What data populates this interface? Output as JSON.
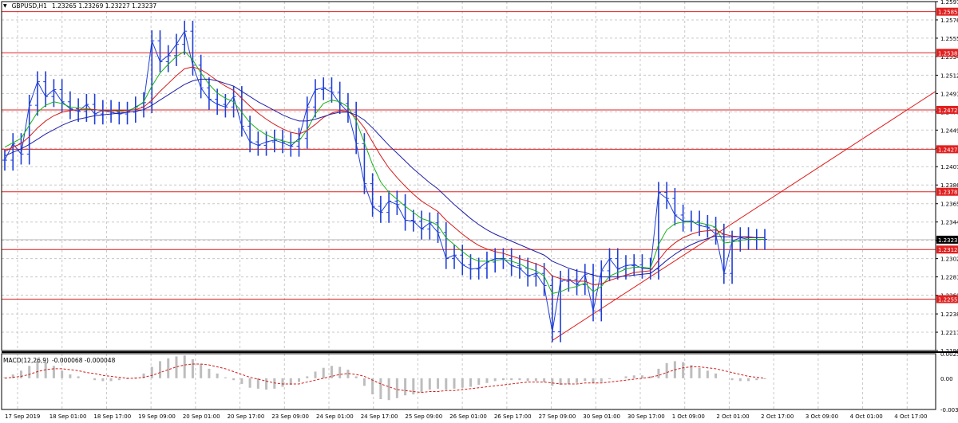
{
  "window": {
    "symbol": "GBPUSD,H1",
    "ohlc": "1.23265 1.23269 1.23227 1.23237",
    "macd_label": "MACD(12,26,9)",
    "macd_values": "-0.000068 -0.000048"
  },
  "colors": {
    "bar": "#1f3fd6",
    "grid": "#c8c8c8",
    "level": "#e02020",
    "ma_fast": "#17b317",
    "ma_mid": "#d41c1c",
    "ma_slow": "#2020a8",
    "trend": "#e02020",
    "macd_hist": "#bdbdbd",
    "macd_signal": "#d41c1c"
  },
  "chart_data": [
    {
      "type": "line",
      "title": "",
      "xlabel": "",
      "ylabel": "",
      "ylim": [
        1.21965,
        1.2597
      ],
      "grid": true,
      "x_tick_labels": [
        "17 Sep 2019",
        "18 Sep 01:00",
        "18 Sep 17:00",
        "19 Sep 09:00",
        "20 Sep 01:00",
        "20 Sep 17:00",
        "23 Sep 09:00",
        "24 Sep 01:00",
        "24 Sep 17:00",
        "25 Sep 09:00",
        "26 Sep 01:00",
        "26 Sep 17:00",
        "27 Sep 09:00",
        "30 Sep 01:00",
        "30 Sep 17:00",
        "1 Oct 09:00",
        "2 Oct 01:00",
        "2 Oct 17:00",
        "3 Oct 09:00",
        "4 Oct 01:00",
        "4 Oct 17:00"
      ],
      "y_tick_labels": [
        "1.25970",
        "1.25760",
        "1.25550",
        "1.25340",
        "1.25125",
        "1.24915",
        "1.24705",
        "1.24495",
        "1.24285",
        "1.24075",
        "1.23865",
        "1.23650",
        "1.23440",
        "1.23230",
        "1.23020",
        "1.22810",
        "1.22600",
        "1.22385",
        "1.22175",
        "1.21965"
      ],
      "price_levels": [
        "1.25854",
        "1.25382",
        "1.24727",
        "1.24275",
        "1.23787",
        "1.23124",
        "1.22555"
      ],
      "current_price": "1.23237",
      "series": [
        {
          "values": [
            1.2415,
            1.2434,
            1.2422,
            1.2478,
            1.2505,
            1.2488,
            1.2496,
            1.2482,
            1.2474,
            1.2471,
            1.2479,
            1.2468,
            1.2472,
            1.247,
            1.2468,
            1.247,
            1.2476,
            1.2481,
            1.2552,
            1.2528,
            1.2535,
            1.2548,
            1.2563,
            1.2524,
            1.2498,
            1.2485,
            1.2479,
            1.2476,
            1.2488,
            1.2454,
            1.2436,
            1.2432,
            1.2436,
            1.2438,
            1.2435,
            1.2431,
            1.244,
            1.2476,
            1.2496,
            1.2498,
            1.2493,
            1.248,
            1.247,
            1.2434,
            1.2388,
            1.2362,
            1.2355,
            1.2368,
            1.2364,
            1.2346,
            1.2345,
            1.2336,
            1.2343,
            1.2332,
            1.2302,
            1.2306,
            1.2295,
            1.229,
            1.2291,
            1.2298,
            1.2302,
            1.2302,
            1.2294,
            1.2291,
            1.2282,
            1.2285,
            1.2271,
            1.2218,
            1.2276,
            1.2278,
            1.2272,
            1.2284,
            1.2242,
            1.2288,
            1.2302,
            1.229,
            1.2294,
            1.2295,
            1.2291,
            1.229,
            1.2378,
            1.2371,
            1.2352,
            1.2345,
            1.2345,
            1.234,
            1.2338,
            1.233,
            1.2285,
            1.2322,
            1.2326,
            1.2324,
            1.2324,
            1.2324
          ]
        },
        {
          "values": [
            1.243,
            1.2435,
            1.244,
            1.2455,
            1.247,
            1.2478,
            1.2482,
            1.248,
            1.2476,
            1.2475,
            1.2474,
            1.2473,
            1.2472,
            1.2472,
            1.2471,
            1.2472,
            1.2475,
            1.2482,
            1.25,
            1.2515,
            1.2525,
            1.2534,
            1.254,
            1.253,
            1.2515,
            1.2502,
            1.2492,
            1.2486,
            1.2482,
            1.247,
            1.2458,
            1.245,
            1.2444,
            1.244,
            1.2437,
            1.2435,
            1.2437,
            1.245,
            1.2468,
            1.248,
            1.2484,
            1.2482,
            1.2476,
            1.246,
            1.2435,
            1.241,
            1.239,
            1.2378,
            1.237,
            1.2362,
            1.2355,
            1.2348,
            1.2345,
            1.234,
            1.2326,
            1.2318,
            1.231,
            1.2303,
            1.2299,
            1.2299,
            1.23,
            1.2301,
            1.2299,
            1.2296,
            1.2291,
            1.2288,
            1.2282,
            1.2262,
            1.2264,
            1.2268,
            1.227,
            1.2274,
            1.2264,
            1.227,
            1.2282,
            1.2286,
            1.229,
            1.2292,
            1.2292,
            1.2291,
            1.2318,
            1.2335,
            1.2342,
            1.2344,
            1.2344,
            1.2343,
            1.2341,
            1.2338,
            1.232,
            1.2321,
            1.2323,
            1.2324,
            1.2324,
            1.2324
          ]
        },
        {
          "values": [
            1.2425,
            1.243,
            1.2434,
            1.2442,
            1.2452,
            1.246,
            1.2466,
            1.247,
            1.2472,
            1.2473,
            1.2473,
            1.2473,
            1.2472,
            1.2472,
            1.2472,
            1.2472,
            1.2473,
            1.2476,
            1.2484,
            1.2494,
            1.2503,
            1.2512,
            1.252,
            1.2522,
            1.2519,
            1.2513,
            1.2506,
            1.25,
            1.2495,
            1.2486,
            1.2477,
            1.2469,
            1.2462,
            1.2456,
            1.2451,
            1.2447,
            1.2445,
            1.2449,
            1.2456,
            1.2464,
            1.2469,
            1.2472,
            1.2471,
            1.2464,
            1.2452,
            1.2436,
            1.242,
            1.2406,
            1.2395,
            1.2385,
            1.2376,
            1.2368,
            1.2362,
            1.2356,
            1.2346,
            1.2338,
            1.233,
            1.2323,
            1.2317,
            1.2313,
            1.231,
            1.2308,
            1.2305,
            1.2302,
            1.2299,
            1.2296,
            1.2292,
            1.2282,
            1.2279,
            1.2277,
            1.2276,
            1.2276,
            1.2272,
            1.2273,
            1.2277,
            1.228,
            1.2283,
            1.2286,
            1.2287,
            1.2288,
            1.23,
            1.2312,
            1.232,
            1.2326,
            1.233,
            1.2333,
            1.2334,
            1.2335,
            1.233,
            1.2328,
            1.2327,
            1.2326,
            1.2326,
            1.2326
          ]
        },
        {
          "values": [
            1.242,
            1.2424,
            1.2428,
            1.2433,
            1.2439,
            1.2445,
            1.245,
            1.2455,
            1.2459,
            1.2462,
            1.2464,
            1.2466,
            1.2467,
            1.2468,
            1.2469,
            1.247,
            1.2471,
            1.2473,
            1.2478,
            1.2484,
            1.249,
            1.2496,
            1.2502,
            1.2506,
            1.2508,
            1.2508,
            1.2506,
            1.2503,
            1.25,
            1.2494,
            1.2488,
            1.2482,
            1.2477,
            1.2472,
            1.2467,
            1.2463,
            1.246,
            1.246,
            1.2462,
            1.2465,
            1.2468,
            1.247,
            1.247,
            1.2467,
            1.2461,
            1.2452,
            1.2442,
            1.2432,
            1.2423,
            1.2414,
            1.2405,
            1.2397,
            1.2389,
            1.2382,
            1.2373,
            1.2364,
            1.2356,
            1.2348,
            1.2341,
            1.2335,
            1.233,
            1.2326,
            1.2322,
            1.2318,
            1.2314,
            1.231,
            1.2306,
            1.2299,
            1.2295,
            1.2291,
            1.2288,
            1.2286,
            1.2283,
            1.2281,
            1.2281,
            1.2281,
            1.2282,
            1.2283,
            1.2284,
            1.2285,
            1.2292,
            1.23,
            1.2307,
            1.2313,
            1.2318,
            1.2322,
            1.2325,
            1.2328,
            1.2327,
            1.2327,
            1.2327,
            1.2327,
            1.2326,
            1.2326
          ]
        }
      ]
    },
    {
      "type": "bar",
      "title": "MACD(12,26,9)",
      "ylim": [
        -0.00329,
        0.002587
      ],
      "y_tick_labels": [
        "0.002587",
        "0.00",
        "-0.00329"
      ],
      "series": [
        {
          "values": [
            0.0001,
            0.0004,
            0.0008,
            0.0013,
            0.0018,
            0.0017,
            0.0013,
            0.0008,
            0.0004,
            0.0002,
            0.0,
            -0.0002,
            -0.0003,
            -0.0003,
            -0.0002,
            -0.0001,
            0.0001,
            0.0005,
            0.0012,
            0.0018,
            0.0021,
            0.0023,
            0.0024,
            0.002,
            0.0015,
            0.001,
            0.0005,
            0.0001,
            -0.0002,
            -0.0006,
            -0.001,
            -0.0011,
            -0.0012,
            -0.0011,
            -0.0009,
            -0.0007,
            -0.0004,
            0.0002,
            0.0007,
            0.0011,
            0.0013,
            0.0012,
            0.0009,
            0.0002,
            -0.0008,
            -0.0017,
            -0.0022,
            -0.0023,
            -0.0021,
            -0.0018,
            -0.0017,
            -0.0015,
            -0.0012,
            -0.0011,
            -0.0012,
            -0.0011,
            -0.001,
            -0.0009,
            -0.0007,
            -0.0005,
            -0.0003,
            -0.0002,
            -0.0002,
            -0.0002,
            -0.0003,
            -0.0003,
            -0.0004,
            -0.0008,
            -0.0007,
            -0.0006,
            -0.0005,
            -0.0003,
            -0.0005,
            -0.0004,
            -0.0001,
            0.0,
            0.0002,
            0.0003,
            0.0003,
            0.0002,
            0.001,
            0.0016,
            0.0018,
            0.0017,
            0.0014,
            0.0011,
            0.0008,
            0.0005,
            0.0,
            -0.0002,
            -0.0003,
            -0.0003,
            -0.0002,
            -0.0001
          ]
        },
        {
          "values": [
            0.0,
            0.0001,
            0.0002,
            0.0004,
            0.0007,
            0.0009,
            0.001,
            0.001,
            0.0009,
            0.0008,
            0.0006,
            0.0005,
            0.0003,
            0.0002,
            0.0001,
            0.0,
            0.0,
            0.0001,
            0.0003,
            0.0006,
            0.0009,
            0.0012,
            0.0014,
            0.0015,
            0.0015,
            0.0014,
            0.0012,
            0.001,
            0.0007,
            0.0004,
            0.0001,
            -0.0001,
            -0.0003,
            -0.0005,
            -0.0006,
            -0.0006,
            -0.0006,
            -0.0004,
            -0.0002,
            0.0,
            0.0002,
            0.0004,
            0.0005,
            0.0004,
            0.0002,
            -0.0002,
            -0.0006,
            -0.0009,
            -0.0012,
            -0.0013,
            -0.0014,
            -0.0015,
            -0.0014,
            -0.0014,
            -0.0013,
            -0.0013,
            -0.0012,
            -0.0011,
            -0.001,
            -0.0009,
            -0.0008,
            -0.0007,
            -0.0006,
            -0.0005,
            -0.0004,
            -0.0004,
            -0.0004,
            -0.0005,
            -0.0006,
            -0.0006,
            -0.0006,
            -0.0005,
            -0.0005,
            -0.0005,
            -0.0004,
            -0.0003,
            -0.0002,
            -0.0001,
            0.0,
            0.0001,
            0.0003,
            0.0006,
            0.0009,
            0.0011,
            0.0012,
            0.0012,
            0.0011,
            0.001,
            0.0008,
            0.0006,
            0.0004,
            0.0002,
            0.0001,
            0.0
          ]
        }
      ]
    }
  ]
}
